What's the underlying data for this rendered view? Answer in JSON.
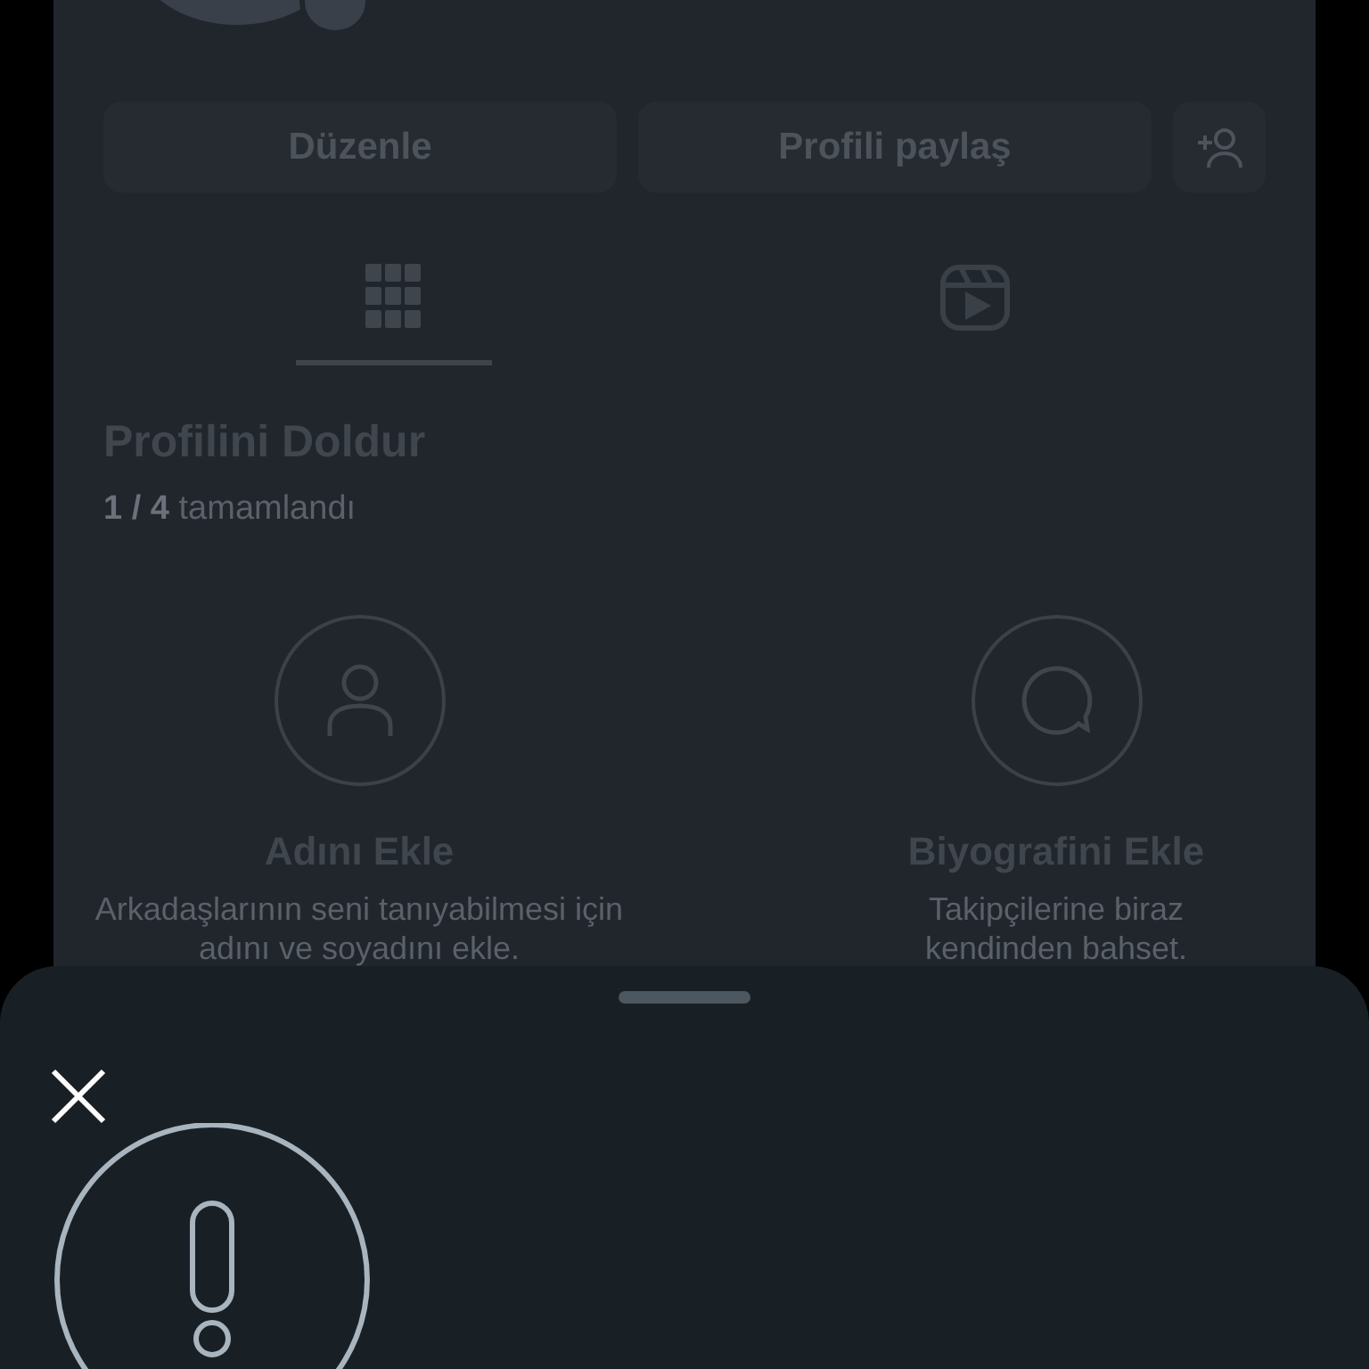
{
  "profile": {
    "buttons": [
      {
        "label": "Düzenle"
      },
      {
        "label": "Profili paylaş"
      }
    ],
    "tabs": [
      {
        "kind": "grid",
        "selected": true
      },
      {
        "kind": "reels",
        "selected": false
      }
    ],
    "completion": {
      "title": "Profilini Doldur",
      "count": "1 / 4",
      "status": "tamamlandı"
    },
    "cards": [
      {
        "kind": "person",
        "title": "Adını Ekle",
        "text": "Arkadaşlarının seni tanıyabilmesi için adını ve soyadını ekle."
      },
      {
        "kind": "bubble",
        "title": "Biyografini Ekle",
        "text": "Takipçilerine biraz kendinden bahset."
      }
    ]
  }
}
